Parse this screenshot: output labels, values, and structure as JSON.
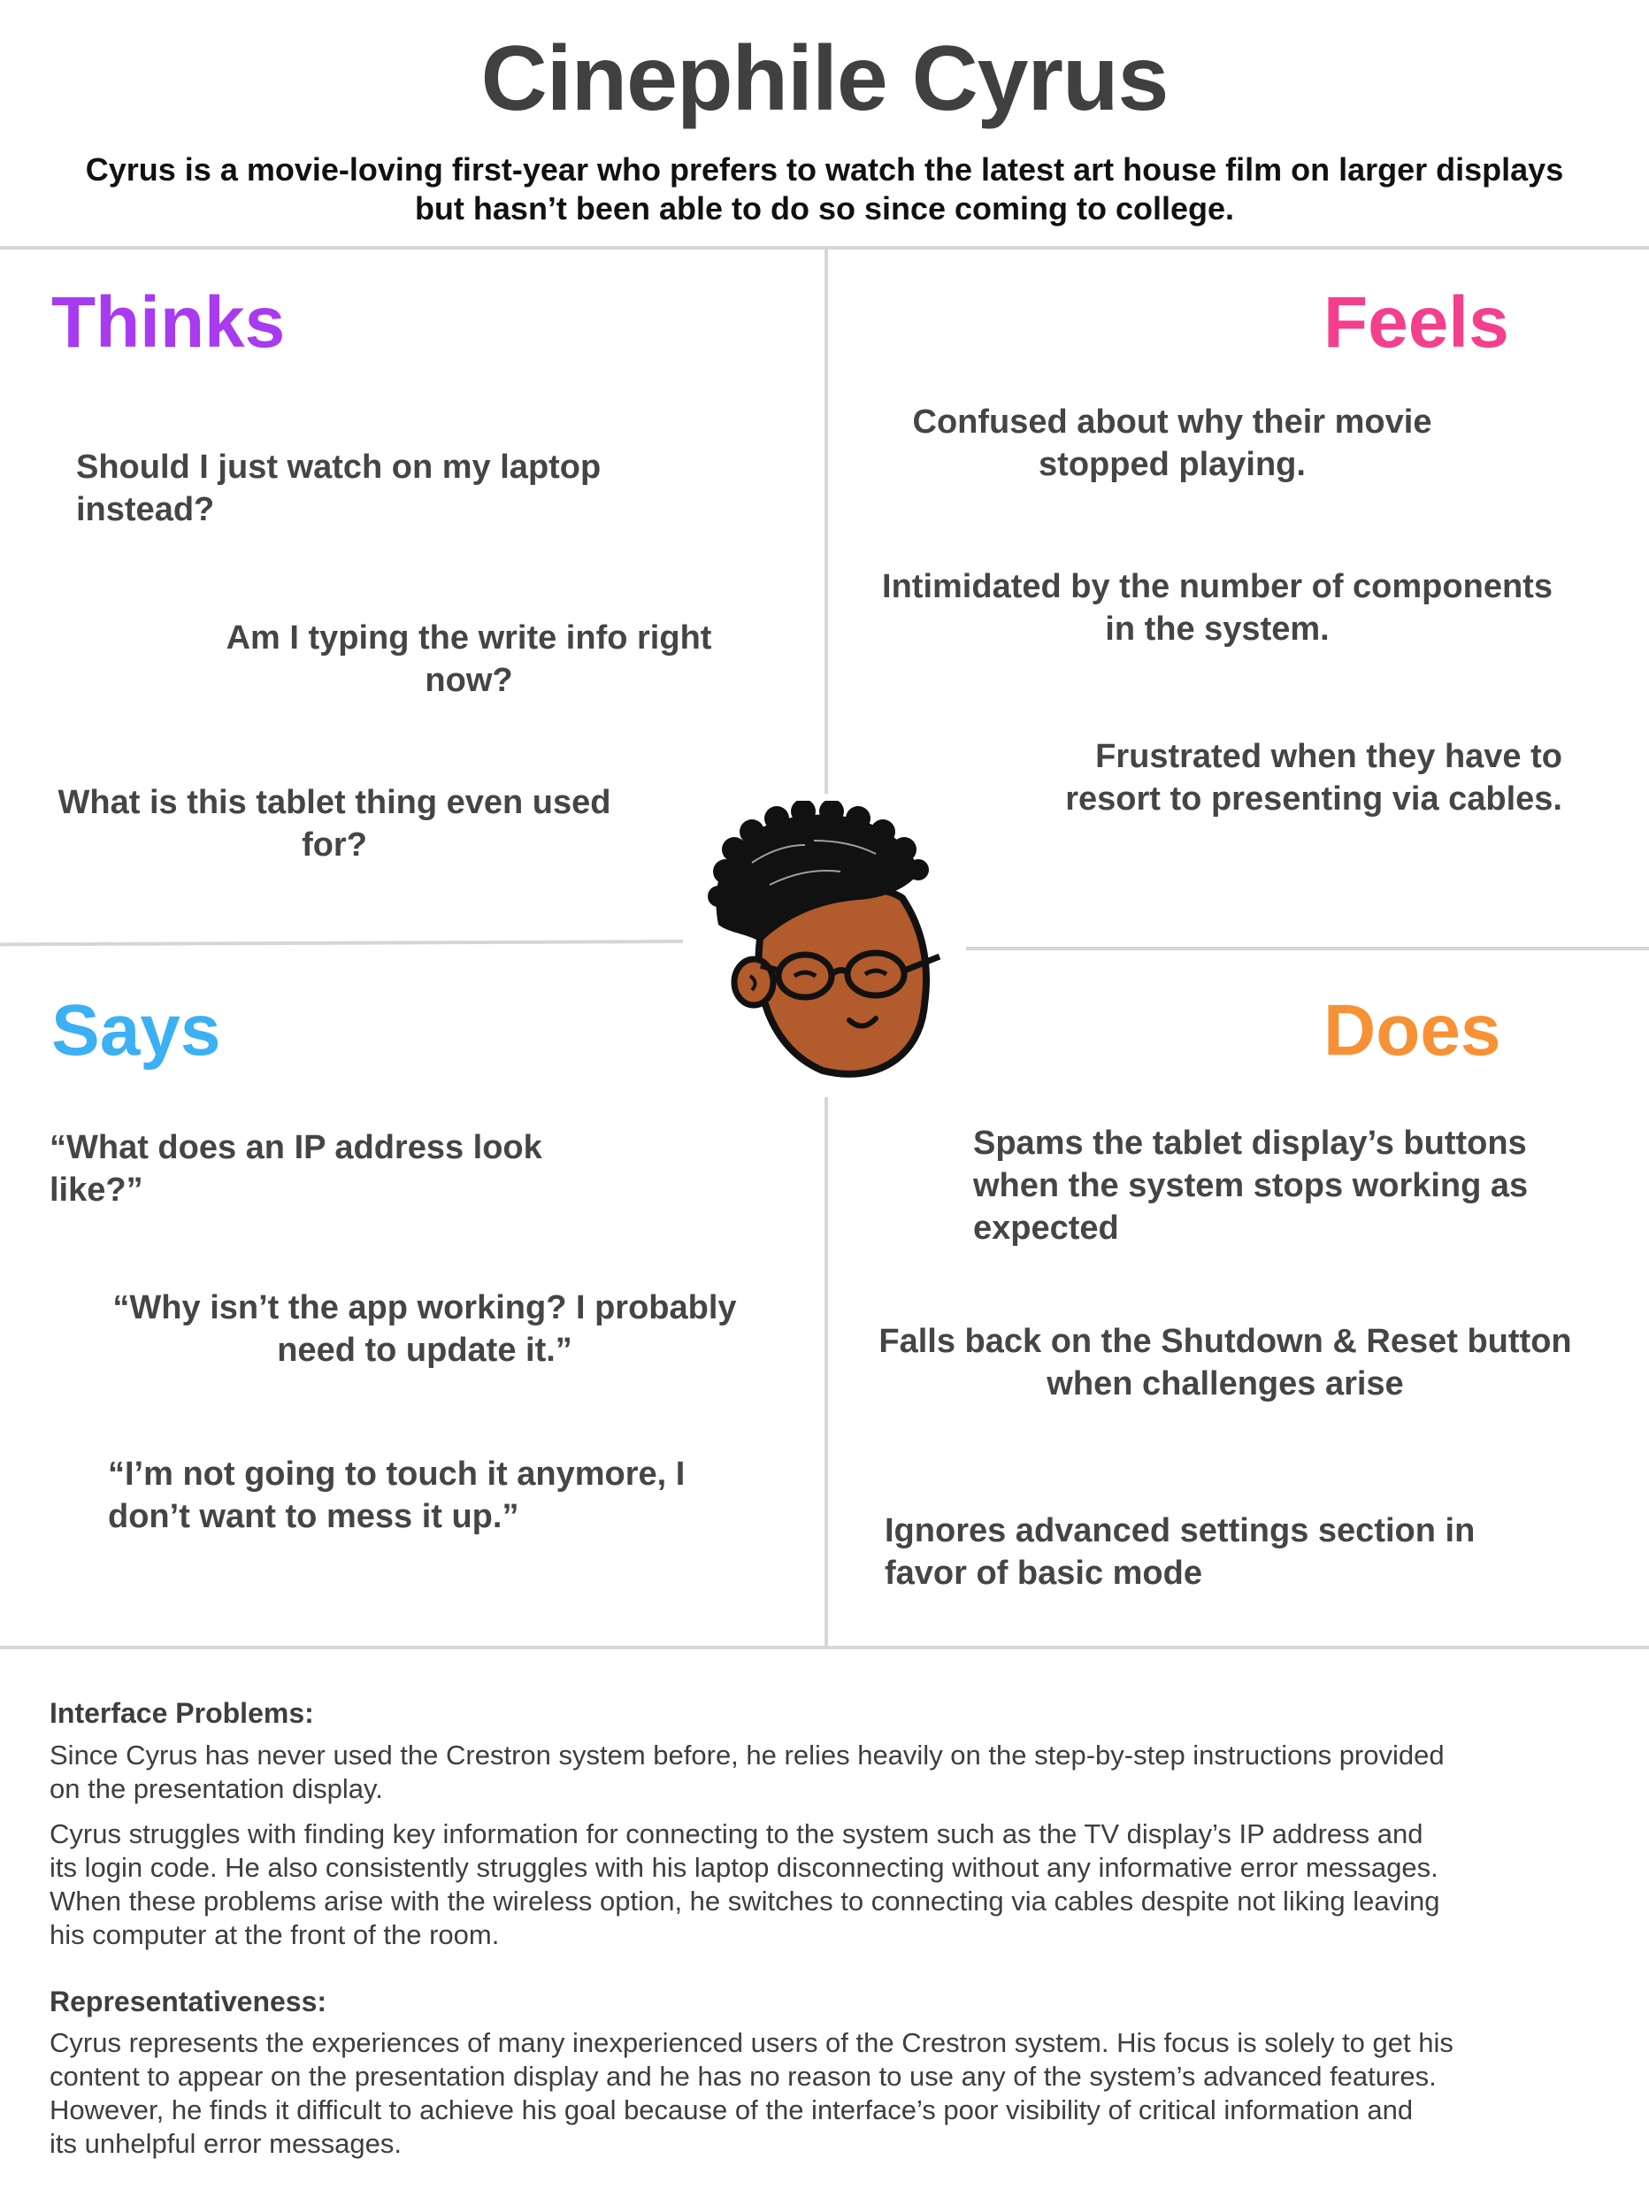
{
  "header": {
    "title": "Cinephile Cyrus",
    "subtitle_line1": "Cyrus is a movie-loving first-year who prefers to watch the latest art house film on larger displays",
    "subtitle_line2": "but hasn’t been able to do so since coming to college."
  },
  "colors": {
    "thinks": "#a83af0",
    "feels": "#f43f8c",
    "says": "#3bb0f3",
    "does": "#f79136"
  },
  "thinks": {
    "heading": "Thinks",
    "notes": [
      {
        "line1": "Should I just watch on my laptop",
        "line2": "instead?"
      },
      {
        "line1": "Am I typing the write info right",
        "line2": "now?"
      },
      {
        "line1": "What is this tablet thing even used",
        "line2": "for?"
      }
    ]
  },
  "feels": {
    "heading": "Feels",
    "notes": [
      {
        "line1": "Confused about why their movie",
        "line2": "stopped playing."
      },
      {
        "line1": "Intimidated by the number of components",
        "line2": "in the system."
      },
      {
        "line1": "Frustrated when they have to",
        "line2": "resort to presenting via cables."
      }
    ]
  },
  "says": {
    "heading": "Says",
    "notes": [
      {
        "line1": "“What does an IP address look",
        "line2": "like?”"
      },
      {
        "line1": "“Why isn’t the app working? I probably",
        "line2": "need to update it.”"
      },
      {
        "line1": "“I’m not going to touch it anymore, I",
        "line2": "don’t want to mess it up.”"
      }
    ]
  },
  "does": {
    "heading": "Does",
    "notes": [
      {
        "line1": "Spams the tablet display’s buttons",
        "line2": "when the system stops working as",
        "line3": "expected"
      },
      {
        "line1": "Falls back on the Shutdown & Reset button",
        "line2": "when challenges arise"
      },
      {
        "line1": "Ignores advanced settings section in",
        "line2": "favor of basic mode"
      }
    ]
  },
  "footer": {
    "problems_heading": "Interface Problems:",
    "problems_p1": [
      "Since Cyrus has never used the Crestron system before, he relies heavily on the step-by-step instructions provided",
      "on the presentation display."
    ],
    "problems_p2": [
      "Cyrus struggles with finding key information for connecting to the system such as the TV display’s IP address and",
      "its login code. He also consistently struggles with his laptop disconnecting without any informative error messages.",
      "When these problems arise with the wireless option, he switches to connecting via cables despite not liking leaving",
      "his computer at the front of the room."
    ],
    "rep_heading": "Representativeness:",
    "rep_p": [
      "Cyrus represents the experiences of many inexperienced users of the Crestron system. His focus is solely to get his",
      "content to appear on the presentation display and he has no reason to use any of the system’s advanced features.",
      "However, he finds it difficult to achieve his goal because of the interface’s poor visibility of critical information and",
      "its unhelpful error messages."
    ]
  },
  "avatar": {
    "icon": "persona-face-icon",
    "skin": "#b25b2c",
    "hair": "#111111"
  }
}
